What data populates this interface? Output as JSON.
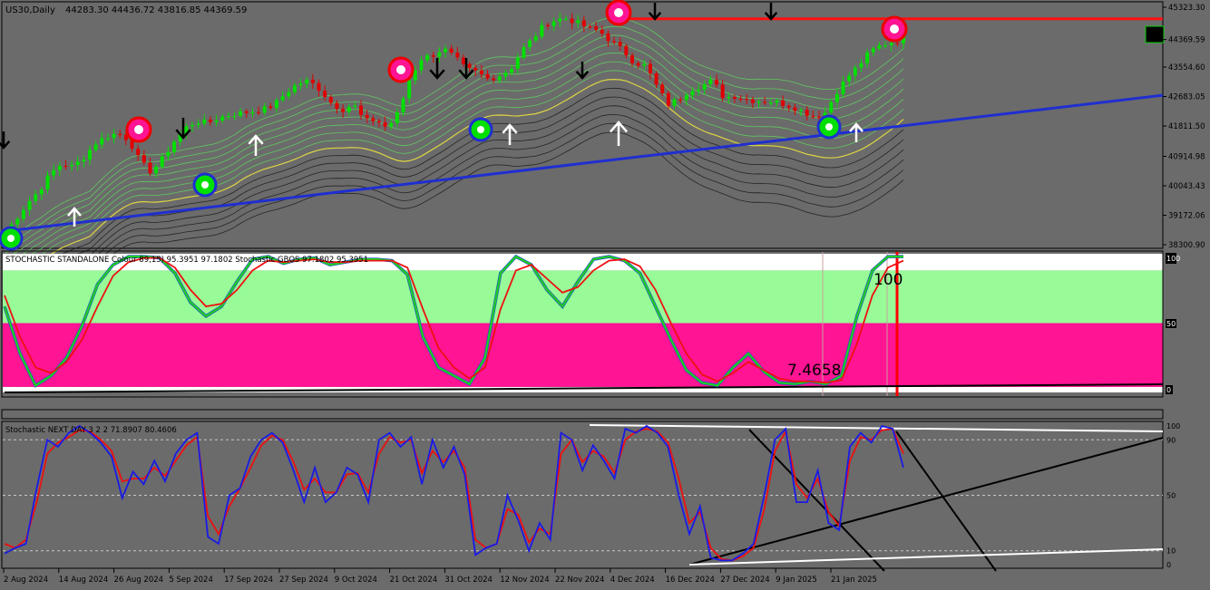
{
  "header": {
    "symbol_tf": "US30,Daily",
    "ohlc": "44283.30 44436.72 43816.85 44369.59"
  },
  "colors": {
    "background": "#6b6b6b",
    "bull": "#00e000",
    "bear": "#e00000",
    "trendline": "#1f2fd0",
    "resistance": "#ff1010",
    "band_green": "#98fb98",
    "band_pink": "#ff1493",
    "stoch_main": "#20d020",
    "stoch_signal": "#ee1010",
    "next_day_main": "#1a1ae6",
    "next_day_signal": "#ee1010"
  },
  "chart_data": [
    {
      "type": "candlestick",
      "title": "US30,Daily",
      "ylim": [
        38300.9,
        45323.3
      ],
      "y_ticks": [
        "45323.30",
        "44369.59",
        "43554.60",
        "42683.05",
        "41811.50",
        "40914.98",
        "40043.43",
        "39172.06",
        "38300.90"
      ],
      "current_price": "44369.59",
      "price_path": [
        38650,
        39100,
        39550,
        39900,
        40400,
        40700,
        40600,
        40900,
        41300,
        41500,
        41600,
        41400,
        40750,
        40450,
        40850,
        41350,
        41750,
        41950,
        41900,
        42050,
        42150,
        42200,
        42250,
        42300,
        42450,
        42800,
        43050,
        43150,
        42900,
        42500,
        42300,
        42450,
        41950,
        42000,
        41750,
        42200,
        43200,
        43800,
        43900,
        44100,
        43850,
        43500,
        43400,
        43200,
        43300,
        43500,
        44050,
        44400,
        44800,
        44950,
        45000,
        44850,
        44700,
        44600,
        44300,
        44050,
        43700,
        43600,
        43000,
        42450,
        42600,
        42900,
        43000,
        43150,
        42650,
        42700,
        42600,
        42550,
        42550,
        42500,
        42400,
        42250,
        42100,
        42200,
        42800,
        43250,
        43600,
        44000,
        44200,
        44300,
        44370
      ],
      "dates": [
        "2 Aug 2024",
        "14 Aug 2024",
        "26 Aug 2024",
        "5 Sep 2024",
        "17 Sep 2024",
        "27 Sep 2024",
        "9 Oct 2024",
        "21 Oct 2024",
        "31 Oct 2024",
        "12 Nov 2024",
        "22 Nov 2024",
        "4 Dec 2024",
        "16 Dec 2024",
        "27 Dec 2024",
        "9 Jan 2025",
        "21 Jan 2025"
      ],
      "trendline": {
        "from": 38700,
        "to": 42720
      },
      "resistance": 44980
    },
    {
      "type": "line",
      "title": "STOCHASTIC STANDALONE Colour 89,15) 95.3951 97.1802  Stochastic GBOS 97.1802 95.3951",
      "ylim": [
        0,
        100
      ],
      "bands": [
        {
          "from": 0,
          "to": 4,
          "color": "white"
        },
        {
          "from": 4,
          "to": 50,
          "color": "pink"
        },
        {
          "from": 50,
          "to": 88,
          "color": "green"
        },
        {
          "from": 88,
          "to": 100,
          "color": "white"
        }
      ],
      "annotations": [
        "100",
        "7.4658"
      ],
      "right_labels": [
        "100",
        "50",
        "0"
      ],
      "series": [
        {
          "values": [
            62,
            28,
            5,
            12,
            25,
            48,
            78,
            92,
            98,
            98,
            97,
            86,
            65,
            55,
            62,
            80,
            96,
            98,
            93,
            96,
            97,
            92,
            94,
            96,
            96,
            95,
            85,
            40,
            18,
            12,
            6,
            25,
            86,
            98,
            92,
            74,
            62,
            80,
            96,
            98,
            95,
            86,
            62,
            38,
            16,
            7,
            5,
            18,
            28,
            15,
            7,
            6,
            8,
            6,
            12,
            55,
            88,
            98,
            98
          ]
        },
        {
          "values": [
            70,
            40,
            18,
            14,
            22,
            38,
            62,
            84,
            94,
            97,
            97,
            90,
            74,
            62,
            64,
            74,
            88,
            95,
            94,
            95,
            96,
            94,
            94,
            95,
            95,
            95,
            90,
            60,
            32,
            18,
            10,
            18,
            60,
            88,
            92,
            82,
            72,
            76,
            88,
            95,
            96,
            91,
            74,
            50,
            28,
            13,
            8,
            14,
            22,
            16,
            10,
            8,
            8,
            7,
            9,
            35,
            70,
            90,
            95
          ]
        }
      ]
    },
    {
      "type": "line",
      "title": "Stochastic NEXT DAY 3 2 2 71.8907 80.4606",
      "ylim": [
        0,
        100
      ],
      "right_labels": [
        "100",
        "90",
        "50",
        "10",
        "0"
      ],
      "series": [
        {
          "name": "main",
          "values": [
            8,
            12,
            15,
            55,
            90,
            85,
            95,
            100,
            95,
            88,
            78,
            48,
            67,
            58,
            75,
            60,
            80,
            90,
            95,
            20,
            15,
            50,
            55,
            78,
            90,
            95,
            88,
            68,
            45,
            70,
            45,
            52,
            70,
            65,
            45,
            90,
            95,
            85,
            92,
            58,
            90,
            70,
            85,
            65,
            7,
            12,
            15,
            50,
            32,
            10,
            30,
            18,
            95,
            90,
            68,
            86,
            75,
            62,
            98,
            95,
            100,
            95,
            85,
            50,
            22,
            42,
            5,
            3,
            3,
            8,
            15,
            50,
            90,
            98,
            45,
            45,
            68,
            30,
            25,
            85,
            95,
            88,
            100,
            98,
            70
          ]
        },
        {
          "name": "signal",
          "values": [
            15,
            12,
            18,
            45,
            80,
            88,
            92,
            97,
            96,
            90,
            82,
            60,
            62,
            62,
            70,
            64,
            75,
            86,
            92,
            35,
            22,
            42,
            55,
            70,
            86,
            93,
            90,
            74,
            54,
            62,
            52,
            52,
            65,
            66,
            52,
            80,
            92,
            88,
            90,
            66,
            82,
            74,
            82,
            70,
            18,
            12,
            15,
            40,
            36,
            16,
            26,
            22,
            80,
            90,
            74,
            82,
            78,
            66,
            90,
            96,
            98,
            96,
            88,
            62,
            30,
            38,
            12,
            4,
            3,
            6,
            12,
            40,
            82,
            96,
            58,
            48,
            62,
            38,
            28,
            75,
            92,
            90,
            97,
            98,
            80
          ]
        }
      ]
    }
  ]
}
